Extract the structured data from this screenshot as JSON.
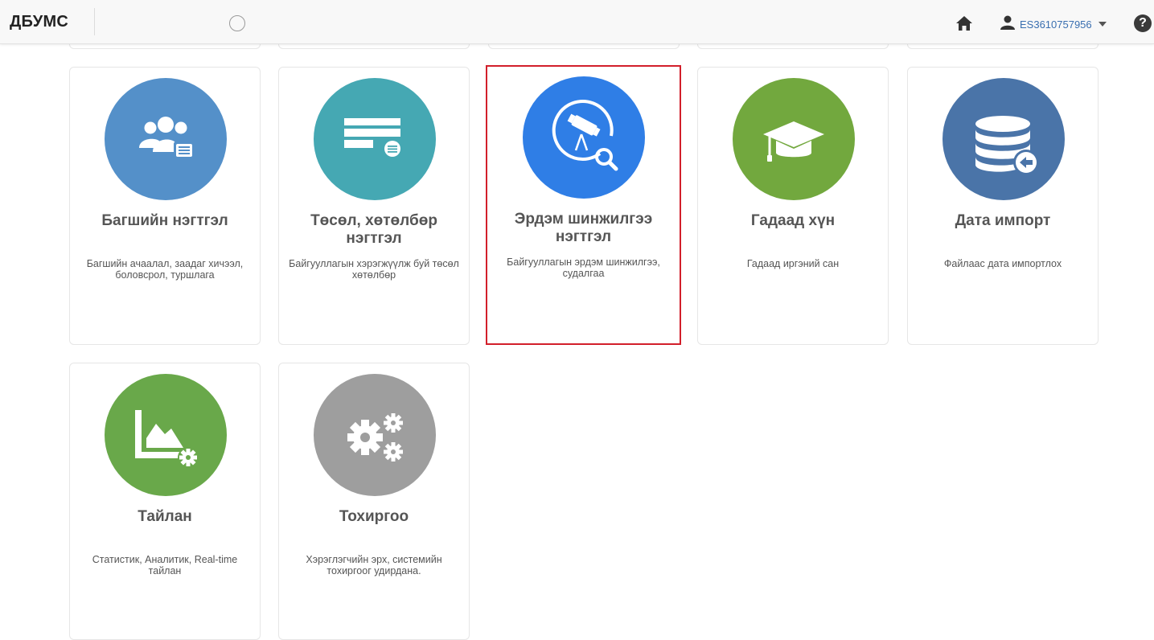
{
  "app": {
    "brand": "ДБУМС"
  },
  "user": {
    "username": "ES3610757956"
  },
  "icons": {
    "home": "home-icon",
    "user": "user-icon",
    "help": "question-circle-icon",
    "loading": "loading-spinner-icon"
  },
  "modules": [
    {
      "title": "Багшийн нэгтгэл",
      "description": "Багшийн ачаалал, заадаг хичээл, боловсрол, туршлага",
      "icon": "users-list-icon",
      "color": "#5490c9"
    },
    {
      "title": "Төсөл, хөтөлбөр нэгтгэл",
      "description": "Байгууллагын хэрэгжүүлж буй төсөл хөтөлбөр",
      "icon": "project-list-icon",
      "color": "#45a8b3"
    },
    {
      "title": "Эрдэм шинжилгээ нэгтгэл",
      "description": "Байгууллагын эрдэм шинжилгээ, судалгаа",
      "icon": "telescope-search-icon",
      "color": "#2f7ee6",
      "selected": true
    },
    {
      "title": "Гадаад хүн",
      "description": "Гадаад иргэний сан",
      "icon": "graduation-cap-icon",
      "color": "#72a83e"
    },
    {
      "title": "Дата импорт",
      "description": "Файлаас дата импортлох",
      "icon": "database-import-icon",
      "color": "#4a74a8"
    },
    {
      "title": "Тайлан",
      "description": "Статистик, Аналитик, Real-time тайлан",
      "icon": "chart-settings-icon",
      "color": "#69a84a"
    },
    {
      "title": "Тохиргоо",
      "description": "Хэрэглэгчийн эрх, системийн тохиргоог удирдана.",
      "icon": "gears-icon",
      "color": "#9e9e9e"
    }
  ],
  "selection_outline_color": "#d21f2b"
}
